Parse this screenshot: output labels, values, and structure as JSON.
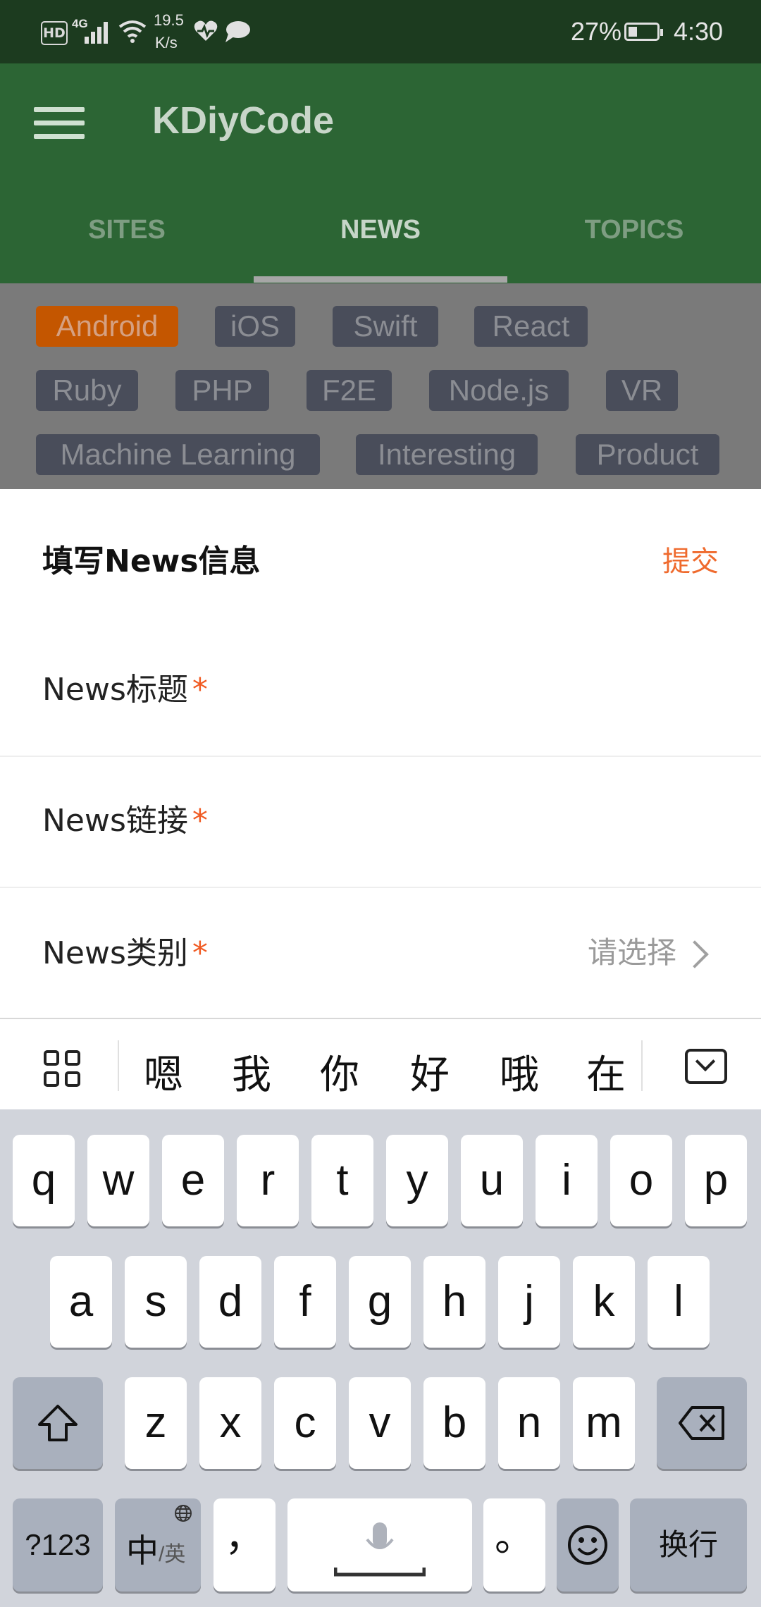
{
  "status_bar": {
    "hd": "HD",
    "network": "4G",
    "speed_value": "19.5",
    "speed_unit": "K/s",
    "battery": "27%",
    "time": "4:30"
  },
  "app_bar": {
    "title": "KDiyCode",
    "tabs": [
      {
        "label": "SITES",
        "active": false
      },
      {
        "label": "NEWS",
        "active": true
      },
      {
        "label": "TOPICS",
        "active": false
      }
    ]
  },
  "tags": [
    {
      "label": "Android",
      "active": true
    },
    {
      "label": "iOS"
    },
    {
      "label": "Swift"
    },
    {
      "label": "React"
    },
    {
      "label": "Ruby"
    },
    {
      "label": "PHP"
    },
    {
      "label": "F2E"
    },
    {
      "label": "Node.js"
    },
    {
      "label": "VR"
    },
    {
      "label": "Machine Learning"
    },
    {
      "label": "Interesting"
    },
    {
      "label": "Product"
    }
  ],
  "sheet": {
    "title": "填写News信息",
    "submit": "提交",
    "fields": [
      {
        "label": "News标题",
        "required": "*"
      },
      {
        "label": "News链接",
        "required": "*"
      },
      {
        "label": "News类别",
        "required": "*",
        "value": "请选择"
      }
    ]
  },
  "keyboard": {
    "candidates": [
      "嗯",
      "我",
      "你",
      "好",
      "哦",
      "在"
    ],
    "row1": [
      "q",
      "w",
      "e",
      "r",
      "t",
      "y",
      "u",
      "i",
      "o",
      "p"
    ],
    "row2": [
      "a",
      "s",
      "d",
      "f",
      "g",
      "h",
      "j",
      "k",
      "l"
    ],
    "row3": [
      "z",
      "x",
      "c",
      "v",
      "b",
      "n",
      "m"
    ],
    "numbers_key": "?123",
    "lang_main": "中",
    "lang_sub": "/英",
    "comma": "，",
    "period": "。",
    "enter": "换行"
  },
  "colors": {
    "status_bar": "#1c3b1f",
    "app_bar": "#2c6534",
    "accent": "#ef6a2d",
    "active_tag": "#c45600"
  }
}
